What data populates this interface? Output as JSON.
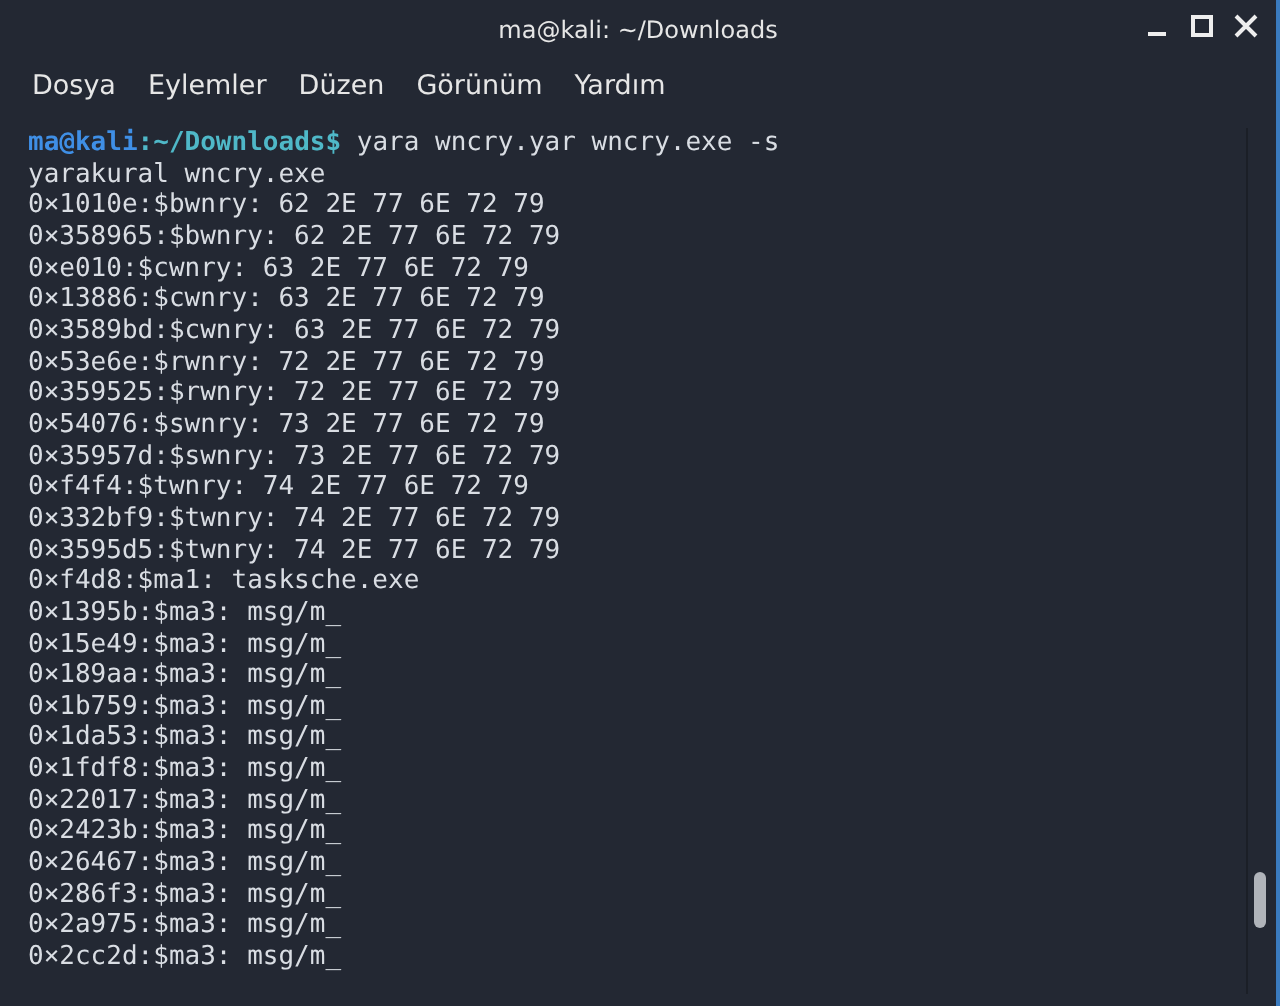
{
  "window": {
    "title": "ma@kali: ~/Downloads"
  },
  "menu": [
    {
      "label": "Dosya"
    },
    {
      "label": "Eylemler"
    },
    {
      "label": "Düzen"
    },
    {
      "label": "Görünüm"
    },
    {
      "label": "Yardım"
    }
  ],
  "terminal": {
    "prompt": {
      "user_host": "ma@kali",
      "path": ":~/Downloads$",
      "command": " yara wncry.yar wncry.exe -s"
    },
    "lines": [
      "yarakural wncry.exe",
      "0×1010e:$bwnry: 62 2E 77 6E 72 79",
      "0×358965:$bwnry: 62 2E 77 6E 72 79",
      "0×e010:$cwnry: 63 2E 77 6E 72 79",
      "0×13886:$cwnry: 63 2E 77 6E 72 79",
      "0×3589bd:$cwnry: 63 2E 77 6E 72 79",
      "0×53e6e:$rwnry: 72 2E 77 6E 72 79",
      "0×359525:$rwnry: 72 2E 77 6E 72 79",
      "0×54076:$swnry: 73 2E 77 6E 72 79",
      "0×35957d:$swnry: 73 2E 77 6E 72 79",
      "0×f4f4:$twnry: 74 2E 77 6E 72 79",
      "0×332bf9:$twnry: 74 2E 77 6E 72 79",
      "0×3595d5:$twnry: 74 2E 77 6E 72 79",
      "0×f4d8:$ma1: tasksche.exe",
      "0×1395b:$ma3: msg/m_",
      "0×15e49:$ma3: msg/m_",
      "0×189aa:$ma3: msg/m_",
      "0×1b759:$ma3: msg/m_",
      "0×1da53:$ma3: msg/m_",
      "0×1fdf8:$ma3: msg/m_",
      "0×22017:$ma3: msg/m_",
      "0×2423b:$ma3: msg/m_",
      "0×26467:$ma3: msg/m_",
      "0×286f3:$ma3: msg/m_",
      "0×2a975:$ma3: msg/m_",
      "0×2cc2d:$ma3: msg/m_"
    ]
  }
}
